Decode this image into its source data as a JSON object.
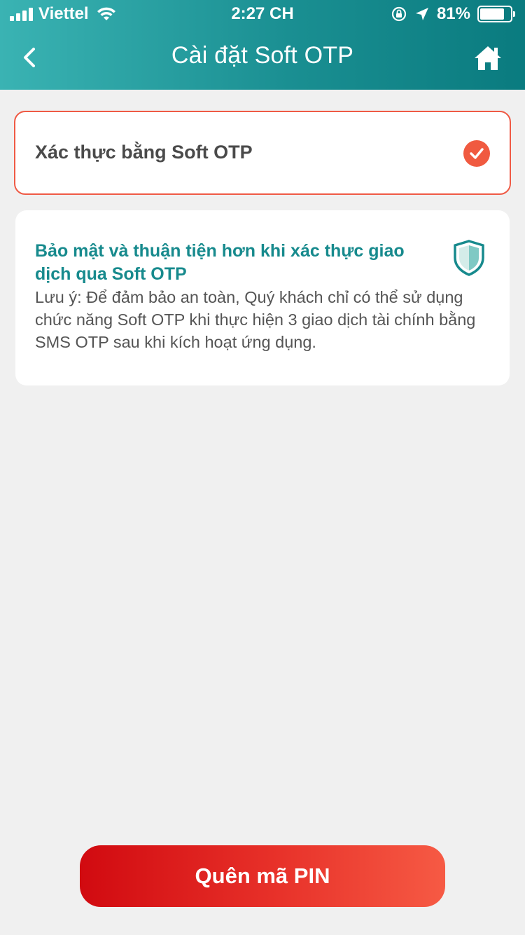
{
  "status_bar": {
    "carrier": "Viettel",
    "time": "2:27 CH",
    "battery": "81%",
    "battery_level": 0.81
  },
  "header": {
    "title": "Cài đặt Soft OTP",
    "back_icon": "chevron-left-icon",
    "home_icon": "home-icon"
  },
  "option": {
    "label": "Xác thực bằng Soft OTP",
    "checked": true,
    "accent": "#f05a40"
  },
  "info": {
    "title": "Bảo mật và thuận tiện hơn khi xác thực giao dịch qua Soft OTP",
    "note": "Lưu ý: Để đảm bảo an toàn, Quý khách chỉ có thể sử dụng chức năng Soft OTP khi thực hiện 3 giao dịch tài chính bằng SMS OTP sau khi kích hoạt ứng dụng.",
    "icon": "shield-icon",
    "accent": "#178a8d"
  },
  "footer": {
    "button_label": "Quên mã PIN"
  }
}
